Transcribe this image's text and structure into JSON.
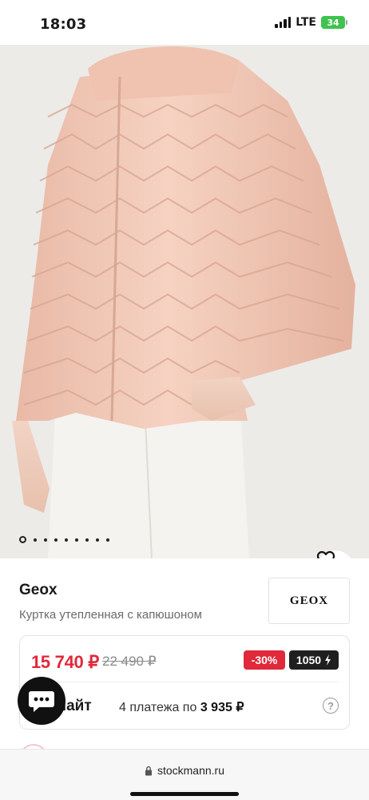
{
  "status_bar": {
    "time": "18:03",
    "network": "LTE",
    "battery": "34"
  },
  "gallery": {
    "image": "pink quilted puffer jacket with hood",
    "dot_count": 9,
    "active_index": 0
  },
  "product": {
    "brand": "Geox",
    "description": "Куртка утепленная с капюшоном",
    "brand_logo_text": "GEOX"
  },
  "price": {
    "current": "15 740 ₽",
    "old": "22 490 ₽",
    "discount": "-30%",
    "bonus": "1050",
    "split_label": "лайт",
    "split_text": "4 платежа по",
    "split_amount": "3 935 ₽"
  },
  "browser": {
    "url": "stockmann.ru"
  },
  "colors": {
    "accent_red": "#e0293a",
    "jacket": "#f0c5b0",
    "dark": "#1f1f1f"
  },
  "icons": [
    "signal-icon",
    "battery-icon",
    "heart-icon",
    "help-icon",
    "chat-icon",
    "lock-icon"
  ]
}
